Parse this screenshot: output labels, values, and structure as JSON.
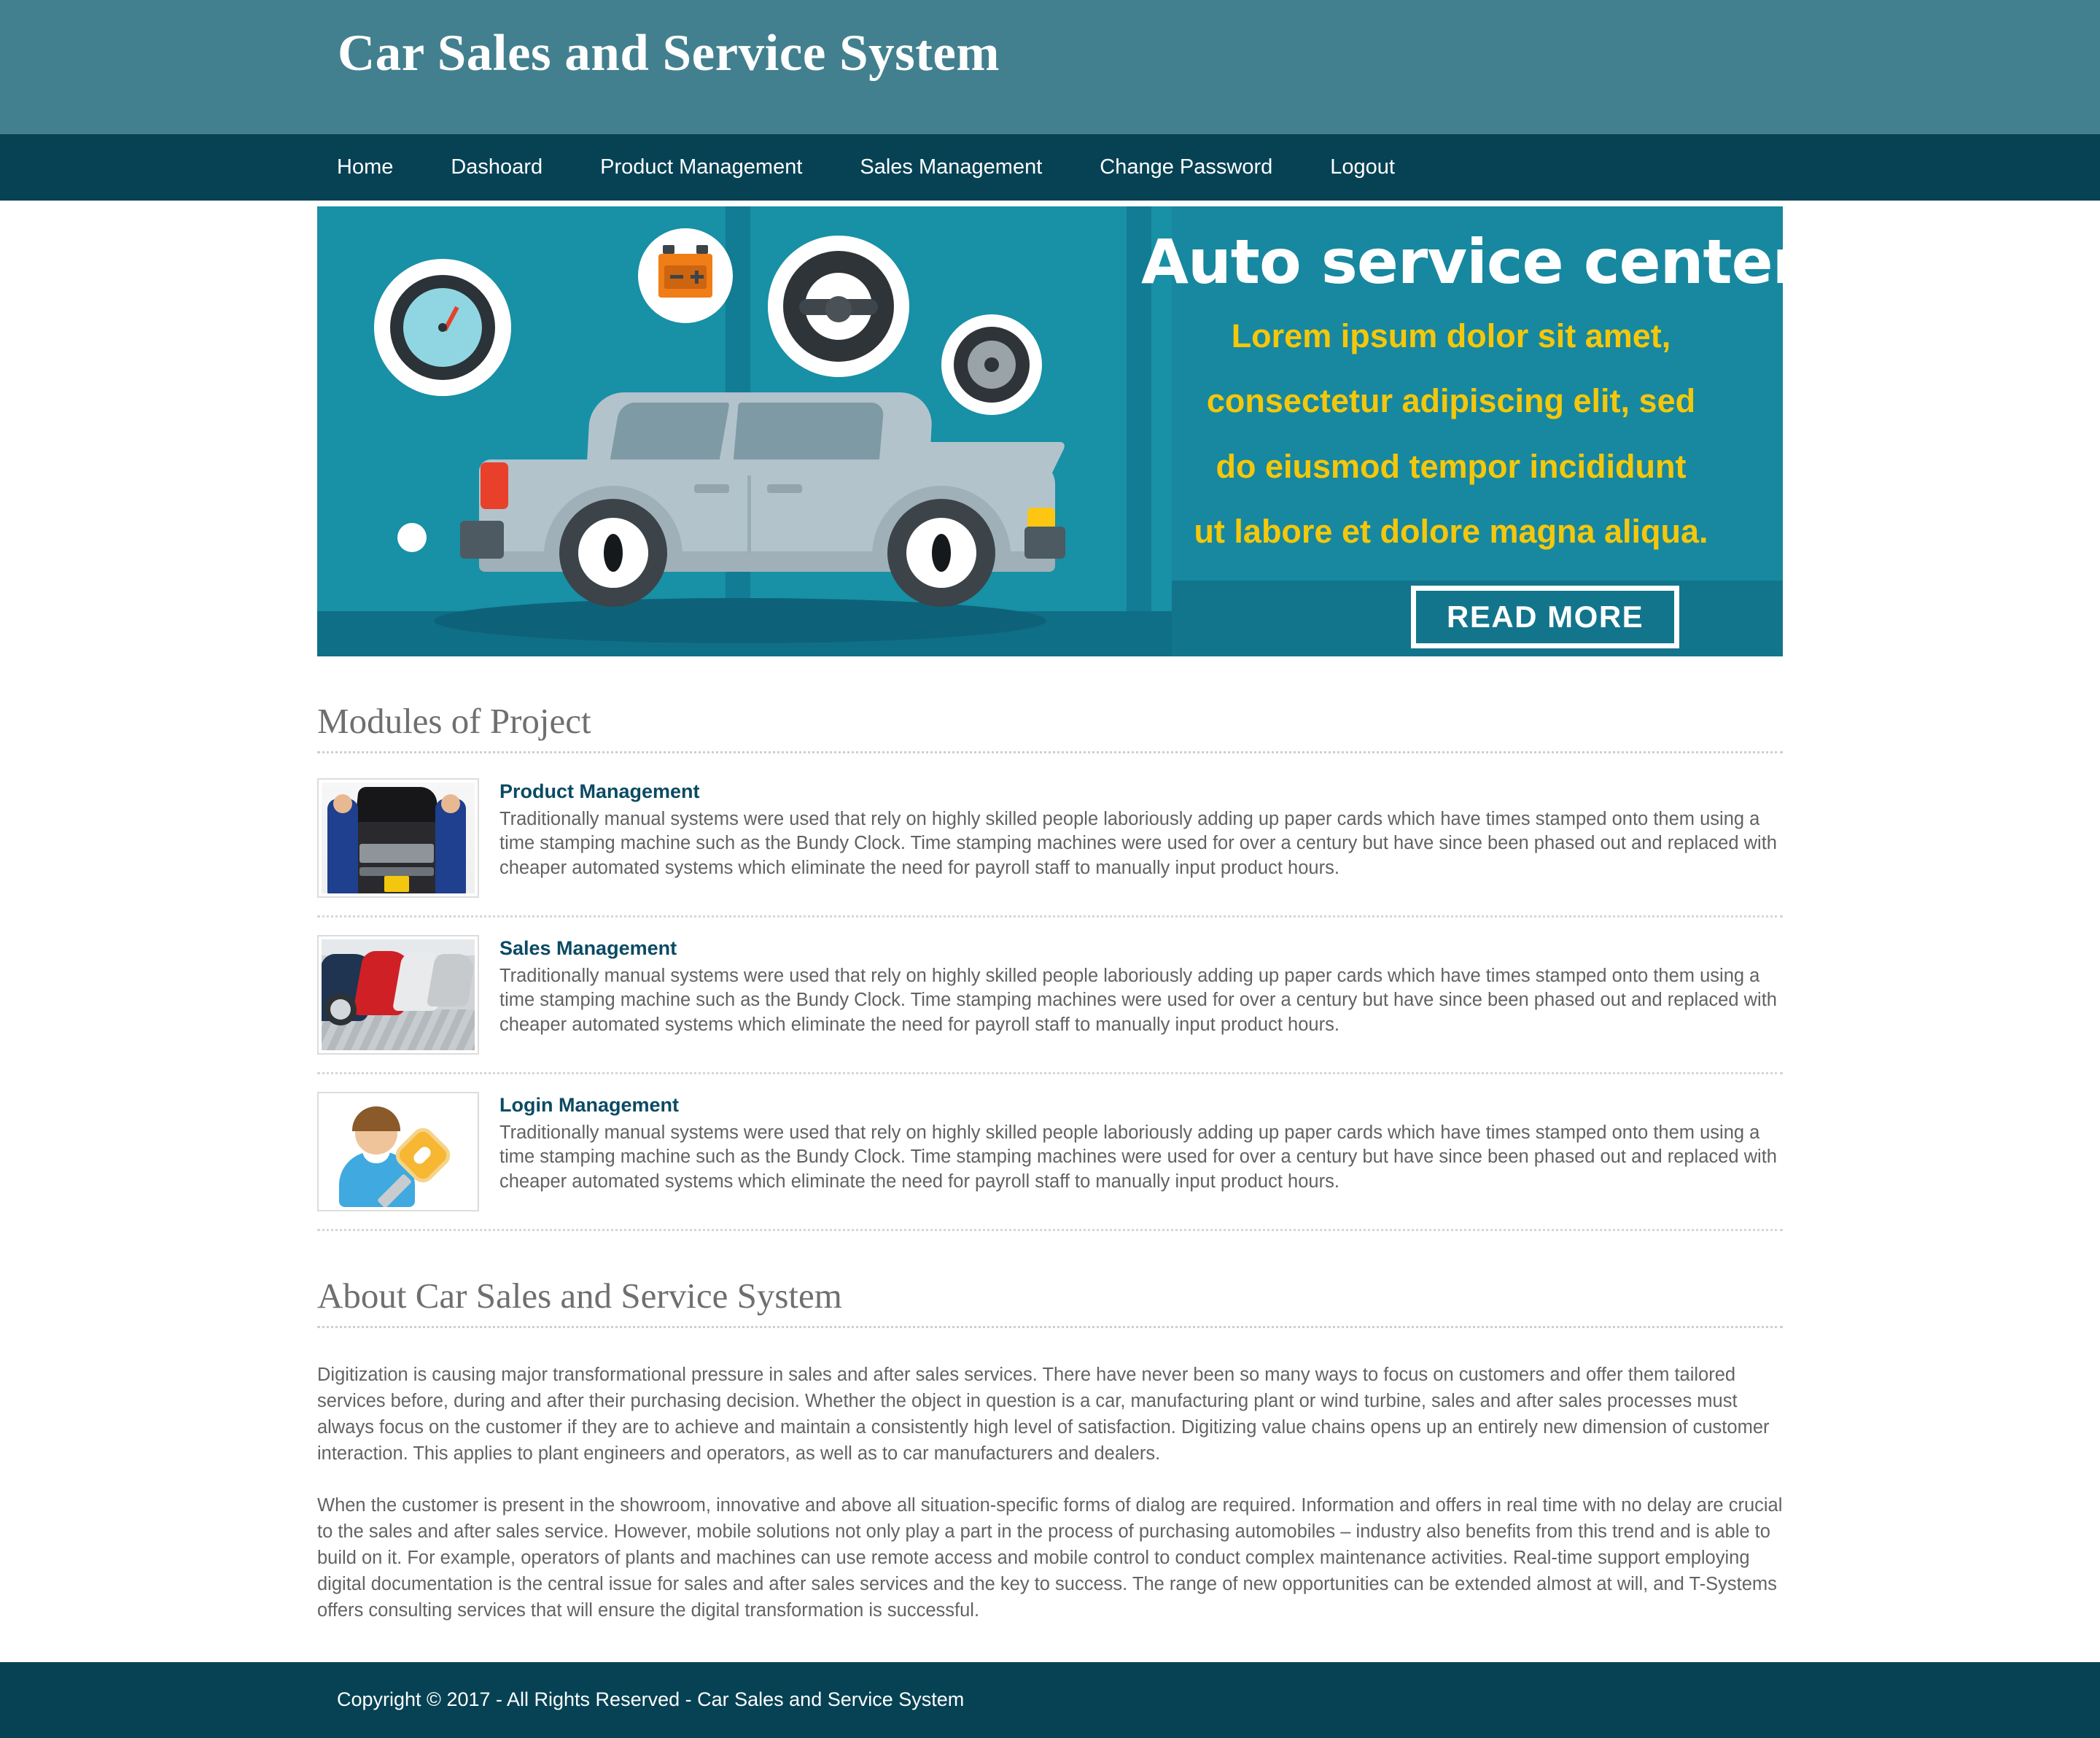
{
  "header": {
    "title": "Car Sales and Service System",
    "bg_color": "#42808f"
  },
  "nav": {
    "bg_color": "#064254",
    "items": [
      {
        "label": "Home"
      },
      {
        "label": "Dashoard"
      },
      {
        "label": "Product Management"
      },
      {
        "label": "Sales Management"
      },
      {
        "label": "Change Password"
      },
      {
        "label": "Logout"
      }
    ]
  },
  "banner": {
    "bg_color": "#17889f",
    "heading": "Auto service center",
    "line1": "Lorem ipsum dolor sit amet,",
    "line2": "consectetur adipiscing elit, sed",
    "line3": "do eiusmod tempor incididunt",
    "line4": "ut labore et dolore magna aliqua.",
    "subtext_color": "#f5c70b",
    "button_label": "READ MORE"
  },
  "modules_section": {
    "title": "Modules of Project",
    "items": [
      {
        "title": "Product Management",
        "icon": "mechanics-photo",
        "description": "Traditionally manual systems were used that rely on highly skilled people laboriously adding up paper cards which have times stamped onto them using a time stamping machine such as the Bundy Clock. Time stamping machines were used for over a century but have since been phased out and replaced with cheaper automated systems which eliminate the need for payroll staff to manually input product hours."
      },
      {
        "title": "Sales Management",
        "icon": "car-lot-photo",
        "description": "Traditionally manual systems were used that rely on highly skilled people laboriously adding up paper cards which have times stamped onto them using a time stamping machine such as the Bundy Clock. Time stamping machines were used for over a century but have since been phased out and replaced with cheaper automated systems which eliminate the need for payroll staff to manually input product hours."
      },
      {
        "title": "Login Management",
        "icon": "user-key-icon",
        "description": "Traditionally manual systems were used that rely on highly skilled people laboriously adding up paper cards which have times stamped onto them using a time stamping machine such as the Bundy Clock. Time stamping machines were used for over a century but have since been phased out and replaced with cheaper automated systems which eliminate the need for payroll staff to manually input product hours."
      }
    ]
  },
  "about_section": {
    "title": "About Car Sales and Service System",
    "paragraph1": "Digitization is causing major transformational pressure in sales and after sales services. There have never been so many ways to focus on customers and offer them tailored services before, during and after their purchasing decision. Whether the object in question is a car, manufacturing plant or wind turbine, sales and after sales processes must always focus on the customer if they are to achieve and maintain a consistently high level of satisfaction. Digitizing value chains opens up an entirely new dimension of customer interaction. This applies to plant engineers and operators, as well as to car manufacturers and dealers.",
    "paragraph2": "When the customer is present in the showroom, innovative and above all situation-specific forms of dialog are required. Information and offers in real time with no delay are crucial to the sales and after sales service. However, mobile solutions not only play a part in the process of purchasing automobiles – industry also benefits from this trend and is able to build on it. For example, operators of plants and machines can use remote access and mobile control to conduct complex maintenance activities. Real-time support employing digital documentation is the central issue for sales and after sales services and the key to success. The range of new opportunities can be extended almost at will, and T-Systems offers consulting services that will ensure the digital transformation is successful."
  },
  "footer": {
    "text": "Copyright © 2017 - All Rights Reserved - Car Sales and Service System",
    "bg_color": "#064254"
  }
}
